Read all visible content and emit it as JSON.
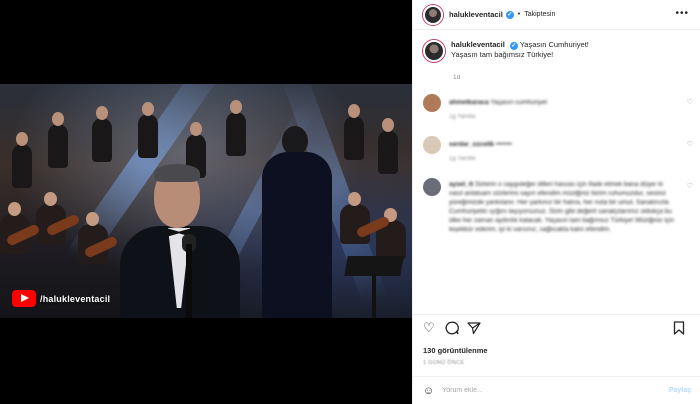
{
  "media": {
    "channel_label": "/halukleventacil"
  },
  "post": {
    "username": "halukleventacil",
    "follow_status": "Takiptesin",
    "caption_line1": "Yaşasın Cumhuriyet!",
    "caption_line2": "Yaşasın tam bağımsız Türkiye!",
    "age": "1d"
  },
  "comments": [
    {
      "user": "ahmetkaraca",
      "text": "Yaşasın cumhuriyet",
      "meta": "1g   Yanıtla"
    },
    {
      "user": "serdar_ozcelik",
      "text": "•••••••",
      "meta": "1g   Yanıtla"
    },
    {
      "user": "aysel_tt",
      "text": "Sizlerin o saygıdeğer dilleri hassas için ifade etmek bana düşer ki nasıl anlatsam sözlerimi sayın efendim müziğiniz bizim ruhumuzdur, sesiniz yüreğimizde yankılanır. Her şarkınız bir hatıra, her nota bir umut. Sanatınızla Cumhuriyetin ışığını taşıyorsunuz. Sizin gibi değerli sanatçılarımız oldukça bu ülke her zaman aydınlık kalacak. Yaşasın tam bağımsız Türkiye! Müziğiniz için teşekkür ederim, iyi ki varsınız, sağlıcakla kalın efendim.",
      "meta": ""
    }
  ],
  "actions": {
    "like_icon": "heart-icon",
    "comment_icon": "comment-icon",
    "share_icon": "share-icon",
    "save_icon": "bookmark-icon"
  },
  "views": "130 görüntülenme",
  "posted_ago": "1 GÜNÜ ÖNCE",
  "comment_box": {
    "placeholder": "Yorum ekle...",
    "submit_label": "Paylaş"
  },
  "colors": {
    "verified": "#3897f0",
    "avatar_ring": "#c43a60",
    "share_disabled": "#b3dbff",
    "youtube": "#ff0000"
  }
}
